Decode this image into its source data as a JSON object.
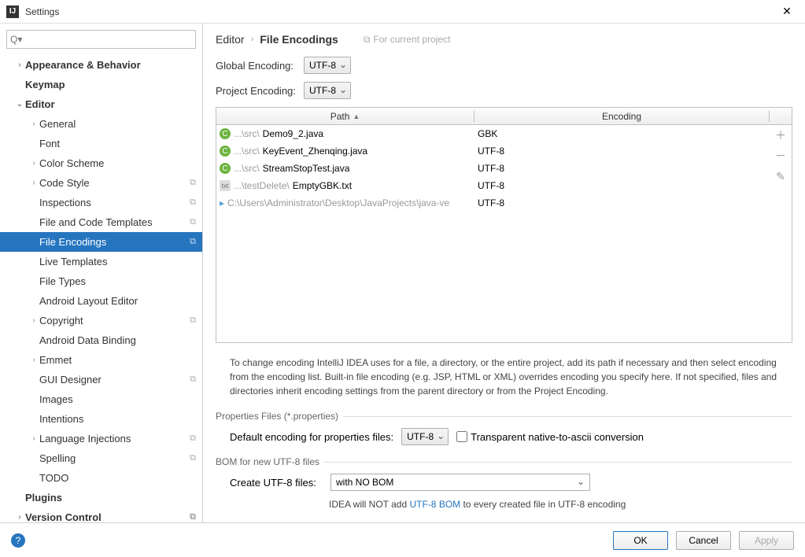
{
  "title": "Settings",
  "search_placeholder": "Q▾",
  "sidebar": [
    {
      "label": "Appearance & Behavior",
      "level": 0,
      "arrow": "›",
      "bold": true
    },
    {
      "label": "Keymap",
      "level": 0,
      "arrow": "",
      "bold": true
    },
    {
      "label": "Editor",
      "level": 0,
      "arrow": "⌄",
      "bold": true
    },
    {
      "label": "General",
      "level": 1,
      "arrow": "›"
    },
    {
      "label": "Font",
      "level": 1,
      "arrow": ""
    },
    {
      "label": "Color Scheme",
      "level": 1,
      "arrow": "›"
    },
    {
      "label": "Code Style",
      "level": 1,
      "arrow": "›",
      "badge": "⧉"
    },
    {
      "label": "Inspections",
      "level": 1,
      "arrow": "",
      "badge": "⧉"
    },
    {
      "label": "File and Code Templates",
      "level": 1,
      "arrow": "",
      "badge": "⧉"
    },
    {
      "label": "File Encodings",
      "level": 1,
      "arrow": "",
      "badge": "⧉",
      "selected": true
    },
    {
      "label": "Live Templates",
      "level": 1,
      "arrow": ""
    },
    {
      "label": "File Types",
      "level": 1,
      "arrow": ""
    },
    {
      "label": "Android Layout Editor",
      "level": 1,
      "arrow": ""
    },
    {
      "label": "Copyright",
      "level": 1,
      "arrow": "›",
      "badge": "⧉"
    },
    {
      "label": "Android Data Binding",
      "level": 1,
      "arrow": ""
    },
    {
      "label": "Emmet",
      "level": 1,
      "arrow": "›"
    },
    {
      "label": "GUI Designer",
      "level": 1,
      "arrow": "",
      "badge": "⧉"
    },
    {
      "label": "Images",
      "level": 1,
      "arrow": ""
    },
    {
      "label": "Intentions",
      "level": 1,
      "arrow": ""
    },
    {
      "label": "Language Injections",
      "level": 1,
      "arrow": "›",
      "badge": "⧉"
    },
    {
      "label": "Spelling",
      "level": 1,
      "arrow": "",
      "badge": "⧉"
    },
    {
      "label": "TODO",
      "level": 1,
      "arrow": ""
    },
    {
      "label": "Plugins",
      "level": 0,
      "arrow": "",
      "bold": true
    },
    {
      "label": "Version Control",
      "level": 0,
      "arrow": "›",
      "bold": true,
      "badge": "⧉"
    }
  ],
  "breadcrumb": {
    "root": "Editor",
    "leaf": "File Encodings",
    "hint": "For current project"
  },
  "globalEncoding": {
    "label": "Global Encoding:",
    "value": "UTF-8"
  },
  "projectEncoding": {
    "label": "Project Encoding:",
    "value": "UTF-8"
  },
  "table": {
    "headers": {
      "path": "Path",
      "encoding": "Encoding"
    },
    "rows": [
      {
        "icon": "java",
        "prefix": "...\\src\\",
        "name": "Demo9_2.java",
        "encoding": "GBK"
      },
      {
        "icon": "java",
        "prefix": "...\\src\\",
        "name": "KeyEvent_Zhenqing.java",
        "encoding": "UTF-8"
      },
      {
        "icon": "java",
        "prefix": "...\\src\\",
        "name": "StreamStopTest.java",
        "encoding": "UTF-8"
      },
      {
        "icon": "txt",
        "prefix": "...\\testDelete\\",
        "name": "EmptyGBK.txt",
        "encoding": "UTF-8"
      },
      {
        "icon": "folder",
        "prefix": "",
        "name": "C:\\Users\\Administrator\\Desktop\\JavaProjects\\java-ve",
        "encoding": "UTF-8",
        "dim": true
      }
    ]
  },
  "description": "To change encoding IntelliJ IDEA uses for a file, a directory, or the entire project, add its path if necessary and then select encoding from the encoding list. Built-in file encoding (e.g. JSP, HTML or XML) overrides encoding you specify here. If not specified, files and directories inherit encoding settings from the parent directory or from the Project Encoding.",
  "properties": {
    "section": "Properties Files (*.properties)",
    "label": "Default encoding for properties files:",
    "value": "UTF-8",
    "checkbox": "Transparent native-to-ascii conversion"
  },
  "bom": {
    "section": "BOM for new UTF-8 files",
    "label": "Create UTF-8 files:",
    "value": "with NO BOM",
    "note_pre": "IDEA will NOT add ",
    "note_link": "UTF-8 BOM",
    "note_post": " to every created file in UTF-8 encoding"
  },
  "buttons": {
    "ok": "OK",
    "cancel": "Cancel",
    "apply": "Apply"
  }
}
